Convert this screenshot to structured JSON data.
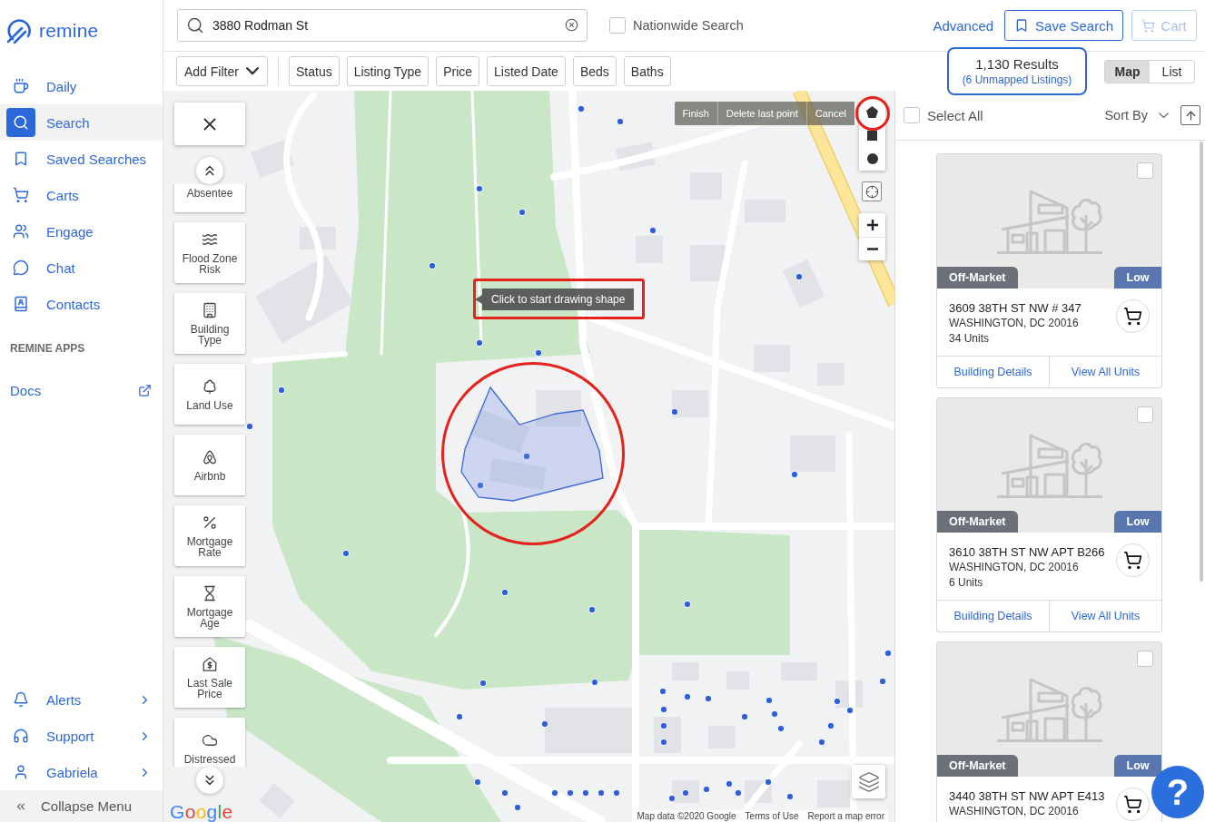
{
  "sidebar": {
    "logo": "remine",
    "nav_items": [
      {
        "label": "Daily",
        "selected": false
      },
      {
        "label": "Search",
        "selected": true
      },
      {
        "label": "Saved Searches",
        "selected": false
      },
      {
        "label": "Carts",
        "selected": false
      },
      {
        "label": "Engage",
        "selected": false
      },
      {
        "label": "Chat",
        "selected": false
      },
      {
        "label": "Contacts",
        "selected": false
      }
    ],
    "apps_title": "REMINE APPS",
    "apps": [
      {
        "label": "Docs"
      }
    ],
    "bottom_items": [
      {
        "label": "Alerts"
      },
      {
        "label": "Support"
      },
      {
        "label": "Gabriela"
      }
    ],
    "collapse_label": "Collapse Menu"
  },
  "top_bar": {
    "search": {
      "value": "3880 Rodman St"
    },
    "nationwide": {
      "label": "Nationwide Search",
      "checked": false
    },
    "advanced": "Advanced",
    "save_search": "Save Search",
    "cart": {
      "label": "Cart",
      "disabled": true
    }
  },
  "filter_bar": {
    "add_filter": "Add Filter",
    "filters": [
      "Status",
      "Listing Type",
      "Price",
      "Listed Date",
      "Beds",
      "Baths"
    ],
    "results": {
      "count": "1,130 Results",
      "unmapped": "(6 Unmapped Listings)"
    },
    "view_toggle": [
      {
        "label": "Map",
        "selected": true
      },
      {
        "label": "List",
        "selected": false
      }
    ]
  },
  "map": {
    "layers": [
      "Absentee",
      "Flood Zone Risk",
      "Building Type",
      "Land Use",
      "Airbnb",
      "Mortgage Rate",
      "Mortgage Age",
      "Last Sale Price",
      "Distressed"
    ],
    "draw_actions": [
      "Finish",
      "Delete last point",
      "Cancel"
    ],
    "draw_shapes": [
      {
        "kind": "polygon"
      },
      {
        "kind": "rectangle"
      },
      {
        "kind": "circle"
      }
    ],
    "tooltip": "Click to start drawing shape",
    "attribution": [
      "Map data ©2020 Google",
      "Terms of Use",
      "Report a map error"
    ],
    "logo": "Google"
  },
  "list_panel": {
    "select_all": {
      "label": "Select All",
      "checked": false
    },
    "sort_label": "Sort By",
    "listings": [
      {
        "status": "Off-Market",
        "tier": "Low",
        "checked": false,
        "address": "3609 38TH ST NW # 347",
        "city": "WASHINGTON, DC 20016",
        "units": "34 Units",
        "links": [
          "Building Details",
          "View All Units"
        ]
      },
      {
        "status": "Off-Market",
        "tier": "Low",
        "checked": false,
        "address": "3610 38TH ST NW APT B266",
        "city": "WASHINGTON, DC 20016",
        "units": "6 Units",
        "links": [
          "Building Details",
          "View All Units"
        ]
      },
      {
        "status": "Off-Market",
        "tier": "Low",
        "checked": false,
        "address": "3440 38TH ST NW APT E413",
        "city": "WASHINGTON, DC 20016"
      }
    ]
  },
  "help_button": "?"
}
